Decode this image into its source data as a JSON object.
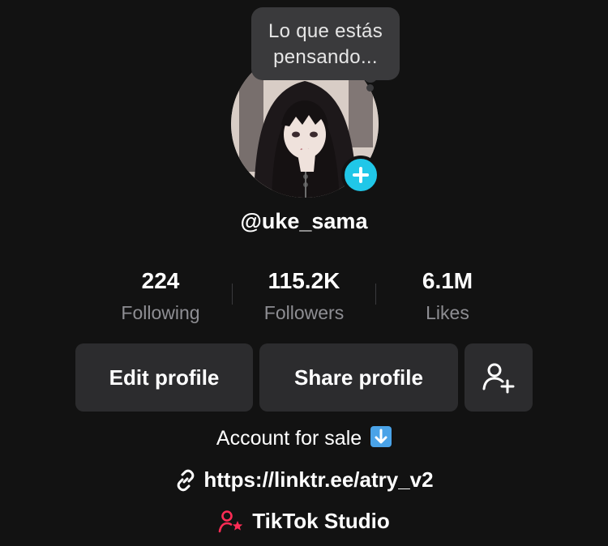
{
  "profile": {
    "thought_bubble": "Lo que estás pensando...",
    "username": "@uke_sama",
    "avatar_icon": "avatar-image",
    "add_icon": "plus-icon"
  },
  "stats": {
    "following": {
      "value": "224",
      "label": "Following"
    },
    "followers": {
      "value": "115.2K",
      "label": "Followers"
    },
    "likes": {
      "value": "6.1M",
      "label": "Likes"
    }
  },
  "actions": {
    "edit_label": "Edit profile",
    "share_label": "Share profile",
    "add_friend_icon": "add-user-icon"
  },
  "bio": {
    "text": "Account for sale",
    "emoji_icon": "down-arrow-emoji-icon",
    "link": "https://linktr.ee/atry_v2",
    "link_icon": "link-icon",
    "studio_label": "TikTok Studio",
    "studio_icon": "tiktok-studio-icon"
  },
  "colors": {
    "background": "#121212",
    "button_bg": "#2c2c2e",
    "muted_text": "#8e8e93",
    "accent_cyan": "#20c7e8",
    "studio_red": "#fe2c55"
  }
}
